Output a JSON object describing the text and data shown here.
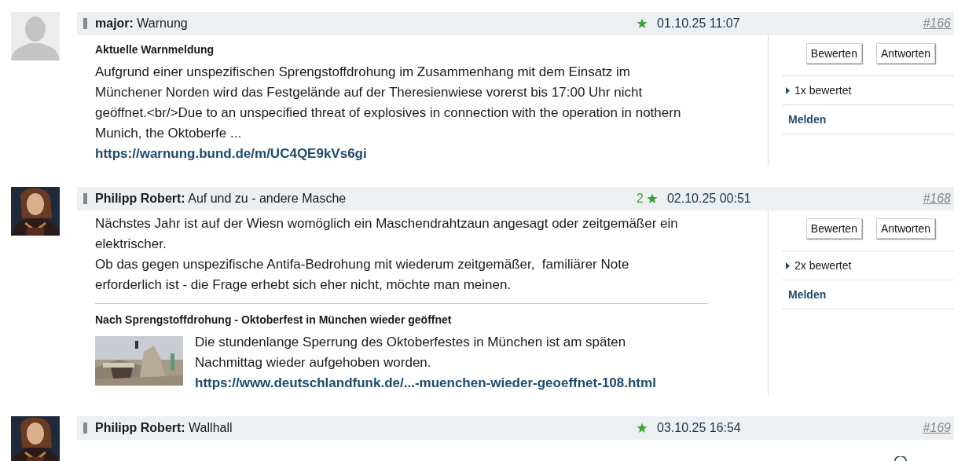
{
  "posts": [
    {
      "avatar": {
        "kind": "placeholder"
      },
      "author": "major:",
      "title": "Warnung",
      "date": "01.10.25 11:07",
      "number": "#166",
      "blocks": [
        {
          "kind": "heading",
          "text": "Aktuelle Warnmeldung"
        },
        {
          "kind": "text",
          "lines": [
            "Aufgrund einer unspezifischen Sprengstoffdrohung im Zusammenhang mit dem Einsatz im",
            "Münchener Norden wird das Festgelände auf der Theresienwiese vorerst bis 17:00 Uhr nicht",
            "geöffnet.<br/>Due to an unspecified threat of explosives in connection with the operation in nothern",
            "Munich, the Oktoberfe ..."
          ]
        },
        {
          "kind": "link",
          "text": "https://warnung.bund.de/m/UC4QE9kVs6gi"
        }
      ],
      "actions": [
        "Bewerten",
        "Antworten"
      ],
      "rated": "1x bewertet",
      "report": "Melden"
    },
    {
      "avatar": {
        "kind": "picture"
      },
      "author": "Philipp Robert:",
      "title": "Auf und zu - andere Masche",
      "rating_count": "2",
      "date": "02.10.25 00:51",
      "number": "#168",
      "blocks": [
        {
          "kind": "text",
          "lines": [
            "Nächstes Jahr ist auf der Wiesn womöglich ein Maschendrahtzaun angesagt oder zeitgemäßer ein",
            "elektrischer.",
            "Ob das gegen unspezifische Antifa-Bedrohung mit wiederum zeitgemäßer,  familiärer Note",
            "erforderlich ist - die Frage erhebt sich eher nicht, möchte man meinen."
          ]
        },
        {
          "kind": "preview",
          "title": "Nach Sprengstoffdrohung - Oktoberfest in München wieder geöffnet",
          "lines": [
            "Die stundenlange Sperrung des Oktoberfestes in München ist am späten",
            "Nachmittag wieder aufgehoben worden."
          ],
          "link": "https://www.deutschlandfunk.de/...-muenchen-wieder-geoeffnet-108.html"
        }
      ],
      "actions": [
        "Bewerten",
        "Antworten"
      ],
      "rated": "2x bewertet",
      "report": "Melden"
    },
    {
      "avatar": {
        "kind": "picture"
      },
      "author": "Philipp Robert:",
      "title": "Wallhall",
      "date": "03.10.25 16:54",
      "number": "#169"
    }
  ]
}
